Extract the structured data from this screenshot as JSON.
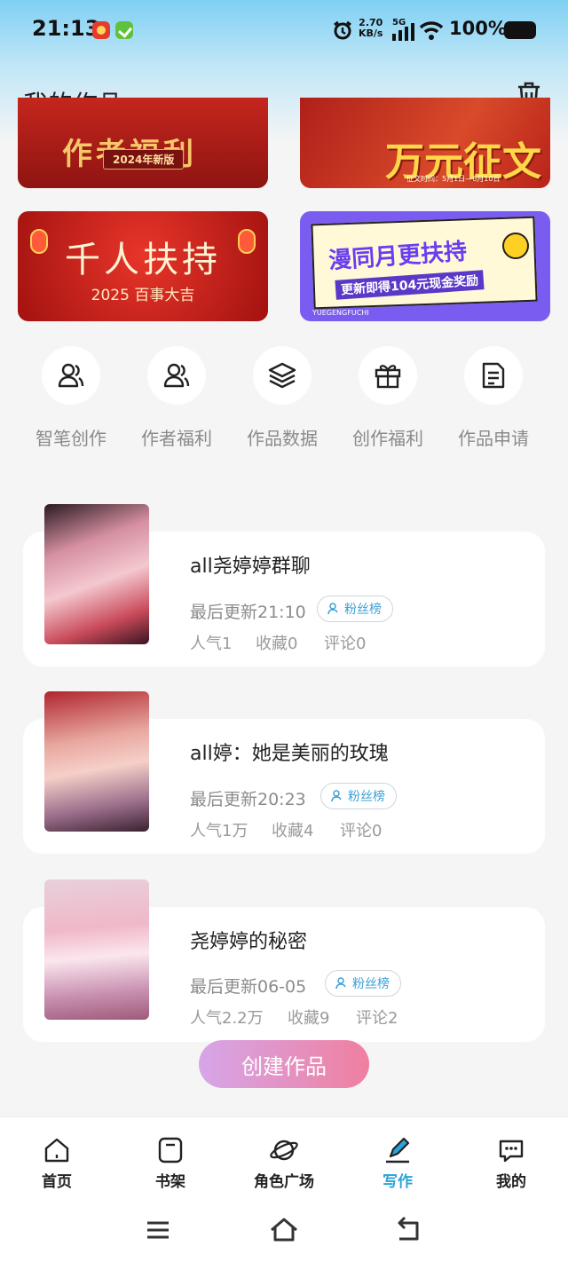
{
  "status_bar": {
    "time": "21:13",
    "net_speed_value": "2.70",
    "net_speed_unit": "KB/s",
    "network": "5G",
    "battery": "100%"
  },
  "header": {
    "title": "我的作品"
  },
  "banners": [
    {
      "title": "作者福利",
      "tag": "2024年新版"
    },
    {
      "title": "万元征文",
      "sub": "征文时间：5月1日—6月10日"
    },
    {
      "title": "千人扶持",
      "sub": "2025 百事大吉"
    },
    {
      "title": "漫同月更扶持",
      "sub": "更新即得104元现金奖励",
      "foot": "YUEGENGFUCHI"
    }
  ],
  "quick_entries": [
    {
      "label": "智笔创作",
      "icon": "users-icon"
    },
    {
      "label": "作者福利",
      "icon": "users-icon"
    },
    {
      "label": "作品数据",
      "icon": "layers-icon"
    },
    {
      "label": "创作福利",
      "icon": "gift-icon"
    },
    {
      "label": "作品申请",
      "icon": "document-icon"
    }
  ],
  "works": [
    {
      "title": "all尧婷婷群聊",
      "update": "最后更新21:10",
      "fans_label": "粉丝榜",
      "popularity": "人气1",
      "favorites": "收藏0",
      "comments": "评论0"
    },
    {
      "title": "all婷：她是美丽的玫瑰",
      "update": "最后更新20:23",
      "fans_label": "粉丝榜",
      "popularity": "人气1万",
      "favorites": "收藏4",
      "comments": "评论0"
    },
    {
      "title": "尧婷婷的秘密",
      "update": "最后更新06-05",
      "fans_label": "粉丝榜",
      "popularity": "人气2.2万",
      "favorites": "收藏9",
      "comments": "评论2"
    }
  ],
  "create_button": "创建作品",
  "tabs": [
    {
      "label": "首页",
      "icon": "home-icon",
      "active": false
    },
    {
      "label": "书架",
      "icon": "bookshelf-icon",
      "active": false
    },
    {
      "label": "角色广场",
      "icon": "planet-icon",
      "active": false
    },
    {
      "label": "写作",
      "icon": "pen-icon",
      "active": true
    },
    {
      "label": "我的",
      "icon": "chat-icon",
      "active": false
    }
  ],
  "colors": {
    "accent": "#2aa3d8",
    "create_gradient_start": "#d6a6e8",
    "create_gradient_end": "#f07fa0",
    "header_gradient": "#7fd0f4"
  }
}
